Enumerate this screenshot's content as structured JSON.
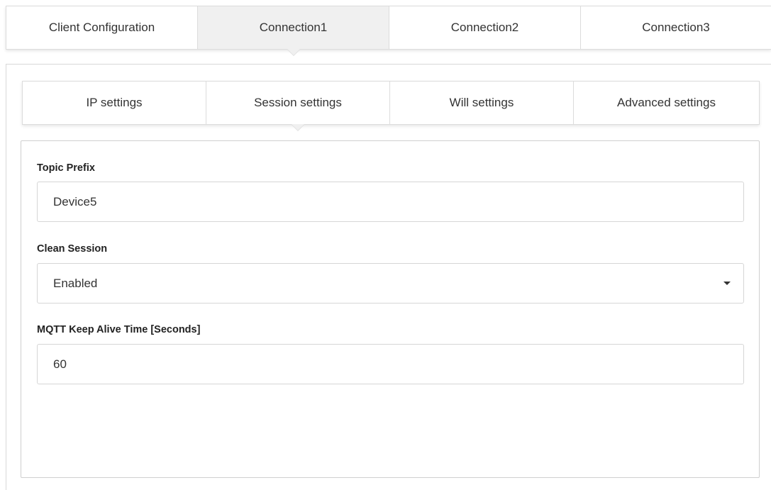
{
  "top_tabs": [
    {
      "label": "Client Configuration",
      "active": false
    },
    {
      "label": "Connection1",
      "active": true
    },
    {
      "label": "Connection2",
      "active": false
    },
    {
      "label": "Connection3",
      "active": false
    }
  ],
  "sub_tabs": [
    {
      "label": "IP settings",
      "active": false
    },
    {
      "label": "Session settings",
      "active": true
    },
    {
      "label": "Will settings",
      "active": false
    },
    {
      "label": "Advanced settings",
      "active": false
    }
  ],
  "form": {
    "topic_prefix": {
      "label": "Topic Prefix",
      "value": "Device5"
    },
    "clean_session": {
      "label": "Clean Session",
      "value": "Enabled",
      "icon": "caret-down-icon"
    },
    "keep_alive": {
      "label": "MQTT Keep Alive Time [Seconds]",
      "value": "60"
    }
  },
  "colors": {
    "active_tab_bg": "#f0f0f0",
    "border": "#dcdcdc",
    "text": "#333333"
  }
}
